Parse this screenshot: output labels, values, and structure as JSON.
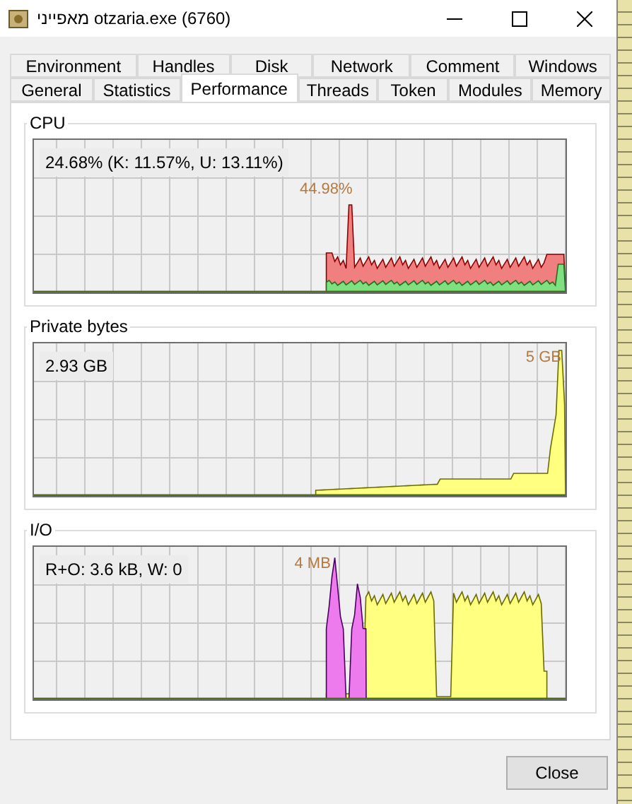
{
  "window": {
    "title": "מאפייני otzaria.exe (6760)"
  },
  "tabs_back": [
    {
      "label": "Environment",
      "selected": false
    },
    {
      "label": "Handles",
      "selected": false
    },
    {
      "label": "Disk",
      "selected": false
    },
    {
      "label": "Network",
      "selected": false
    },
    {
      "label": "Comment",
      "selected": false
    },
    {
      "label": "Windows",
      "selected": false
    }
  ],
  "tabs_front": [
    {
      "label": "General",
      "selected": false
    },
    {
      "label": "Statistics",
      "selected": false
    },
    {
      "label": "Performance",
      "selected": true
    },
    {
      "label": "Threads",
      "selected": false
    },
    {
      "label": "Token",
      "selected": false
    },
    {
      "label": "Modules",
      "selected": false
    },
    {
      "label": "Memory",
      "selected": false
    }
  ],
  "graphs": [
    {
      "kind": "cpu",
      "title": "CPU",
      "reading": "24.68% (K: 11.57%, U: 13.11%)",
      "peak_label": "44.98%"
    },
    {
      "kind": "memory",
      "title": "Private bytes",
      "reading": "2.93 GB",
      "peak_label": "5 GB"
    },
    {
      "kind": "io",
      "title": "I/O",
      "reading": "R+O: 3.6 kB, W: 0",
      "peak_label": "4 MB"
    }
  ],
  "buttons": [
    {
      "label": "Close"
    }
  ]
}
